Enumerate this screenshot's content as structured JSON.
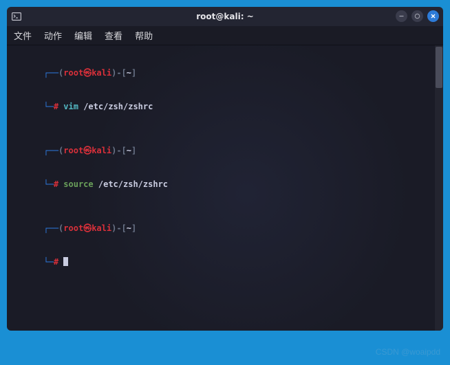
{
  "titlebar": {
    "title": "root@kali: ~"
  },
  "menubar": {
    "items": [
      "文件",
      "动作",
      "编辑",
      "查看",
      "帮助"
    ]
  },
  "prompt": {
    "open_paren": "(",
    "user": "root",
    "symbol": "㉿",
    "host": "kali",
    "close_user": ")-[",
    "cwd": "~",
    "close_bracket": "]",
    "prompt_char": "#"
  },
  "history": [
    {
      "cmd": "vim",
      "arg": "/etc/zsh/zshrc",
      "cmd_class": "p-cyan"
    },
    {
      "cmd": "source",
      "arg": "/etc/zsh/zshrc",
      "cmd_class": "p-green"
    }
  ],
  "watermark": "CSDN @woaipdd"
}
